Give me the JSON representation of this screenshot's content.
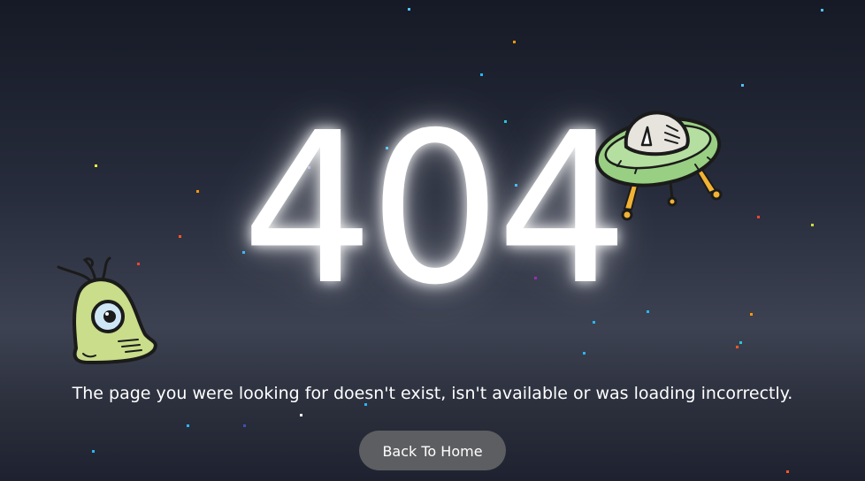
{
  "page": {
    "background_top": "#161a26",
    "background_bottom": "#1e2230"
  },
  "error": {
    "code": "404",
    "message": "The page you were looking for doesn't exist, isn't available or was loading incorrectly.",
    "home_button_label": "Back To Home"
  },
  "illustrations": {
    "ufo": "ufo-icon",
    "alien": "alien-icon"
  },
  "colors": {
    "text": "#ffffff",
    "button_bg": "#5d5e61",
    "alien_green": "#c9dd8a",
    "ufo_green": "#98cf82",
    "ufo_legs": "#f2b233"
  }
}
